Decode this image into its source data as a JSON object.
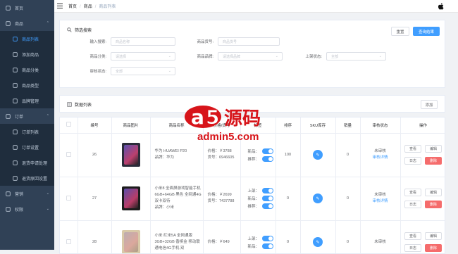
{
  "sidebar": {
    "items": [
      {
        "label": "首页",
        "icon": "home-icon"
      },
      {
        "label": "商品",
        "icon": "goods-icon",
        "expanded": true
      },
      {
        "label": "商品列表",
        "icon": "list-icon",
        "sub": true,
        "active": true
      },
      {
        "label": "添加商品",
        "icon": "add-icon",
        "sub": true
      },
      {
        "label": "商品分类",
        "icon": "category-icon",
        "sub": true
      },
      {
        "label": "商品类型",
        "icon": "type-icon",
        "sub": true
      },
      {
        "label": "品牌管理",
        "icon": "brand-icon",
        "sub": true
      },
      {
        "label": "订单",
        "icon": "order-icon",
        "expanded": true
      },
      {
        "label": "订单列表",
        "icon": "list-icon",
        "sub": true
      },
      {
        "label": "订单设置",
        "icon": "setting-icon",
        "sub": true
      },
      {
        "label": "退货申请处理",
        "icon": "return-icon",
        "sub": true
      },
      {
        "label": "退货原因设置",
        "icon": "reason-icon",
        "sub": true
      },
      {
        "label": "营销",
        "icon": "marketing-icon"
      },
      {
        "label": "权限",
        "icon": "permission-icon"
      }
    ]
  },
  "breadcrumb": {
    "home": "首页",
    "section": "商品",
    "current": "商品列表"
  },
  "filter": {
    "title": "筛选搜索",
    "search_btn": "查询结果",
    "reset_btn": "重置",
    "fields": {
      "keyword": {
        "label": "输入搜索:",
        "placeholder": "商品名称"
      },
      "sn": {
        "label": "商品货号:",
        "placeholder": "商品货号"
      },
      "category": {
        "label": "商品分类:",
        "placeholder": "请选择"
      },
      "brand": {
        "label": "商品品牌:",
        "placeholder": "请选择品牌"
      },
      "publish": {
        "label": "上架状态:",
        "placeholder": "全部"
      },
      "verify": {
        "label": "审核状态:",
        "placeholder": "全部"
      }
    }
  },
  "list": {
    "title": "数据列表",
    "add_btn": "添加",
    "columns": [
      "",
      "编号",
      "商品图片",
      "商品名称",
      "价格/货号",
      "标签",
      "排序",
      "SKU库存",
      "销量",
      "审核状态",
      "操作"
    ],
    "rows": [
      {
        "id": "26",
        "name": "华为 HUAWEI P20",
        "brand": "品牌：华为",
        "price": "价格：￥3788",
        "sn": "货号：6946605",
        "tags": [
          "新品：",
          "推荐："
        ],
        "sort": "100",
        "sales": "0",
        "verify": "未审核",
        "verify_link": "审核详情",
        "img": "#2b2b3a"
      },
      {
        "id": "27",
        "name": "小米8 全面屏游戏智能手机 6GB+64GB 黑色 全网通4G 双卡双待",
        "brand": "品牌：小米",
        "price": "价格：￥2699",
        "sn": "货号：7437788",
        "tags": [
          "上架：",
          "新品：",
          "推荐："
        ],
        "sort": "0",
        "sales": "0",
        "verify": "未审核",
        "verify_link": "审核详情",
        "img": "#1c1c1c"
      },
      {
        "id": "28",
        "name": "小米 红米5A 全网通版 3GB+32GB 香槟金 移动联通电信4G手机 双",
        "brand": "",
        "price": "价格：￥649",
        "sn": "",
        "tags": [
          "上架：",
          "新品："
        ],
        "sort": "0",
        "sales": "0",
        "verify": "未审核",
        "verify_link": "",
        "img": "#d9c9a8"
      }
    ],
    "ops": {
      "view": "查看",
      "edit": "编辑",
      "log": "日志",
      "delete": "删除"
    }
  },
  "watermark": {
    "text": "admin5.com",
    "brand": "源码"
  }
}
